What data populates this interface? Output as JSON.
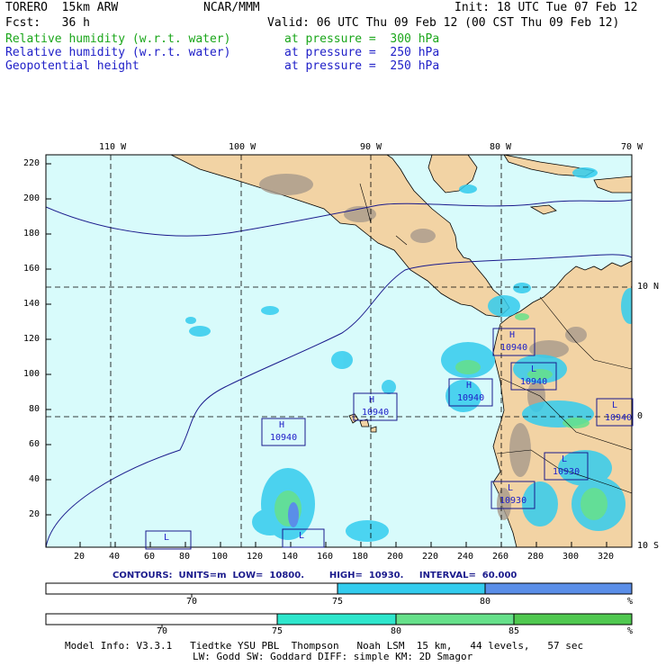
{
  "header": {
    "model": "TORERO  15km ARW",
    "center": "NCAR/MMM",
    "init": "Init: 18 UTC Tue 07 Feb 12",
    "fcst": "Fcst:   36 h",
    "valid": "Valid: 06 UTC Thu 09 Feb 12 (00 CST Thu 09 Feb 12)"
  },
  "fields": [
    {
      "name": "Relative humidity (w.r.t. water)",
      "level": "at pressure =  300 hPa",
      "color": "#1aa61a"
    },
    {
      "name": "Relative humidity (w.r.t. water)",
      "level": "at pressure =  250 hPa",
      "color": "#2020c8"
    },
    {
      "name": "Geopotential height",
      "level": "at pressure =  250 hPa",
      "color": "#2020c8"
    }
  ],
  "map": {
    "lon_labels": [
      "110 W",
      "100 W",
      "90 W",
      "80 W",
      "70 W"
    ],
    "lat_labels": [
      "10 N",
      "0",
      "10 S"
    ],
    "y_ticks": [
      "220",
      "200",
      "180",
      "160",
      "140",
      "120",
      "100",
      "80",
      "60",
      "40",
      "20"
    ],
    "x_ticks": [
      "20",
      "40",
      "60",
      "80",
      "100",
      "120",
      "140",
      "160",
      "180",
      "200",
      "220",
      "240",
      "260",
      "280",
      "300",
      "320"
    ],
    "colors": {
      "ocean": "#d8fbfb",
      "land": "#f2d3a4",
      "terrain": "#a89a8c",
      "contour": "#1a1a8c"
    },
    "highs": [
      {
        "label": "H",
        "value": "10940"
      },
      {
        "label": "H",
        "value": "10940"
      },
      {
        "label": "H",
        "value": "10940"
      },
      {
        "label": "H",
        "value": "10940"
      }
    ],
    "lows": [
      {
        "label": "L",
        "value": "10940"
      },
      {
        "label": "L",
        "value": "10940"
      },
      {
        "label": "L",
        "value": "10930"
      },
      {
        "label": "L",
        "value": "10930"
      },
      {
        "label": "L",
        "value": ""
      },
      {
        "label": "L",
        "value": "10930"
      }
    ]
  },
  "contours": {
    "text": "CONTOURS:  UNITS=m  LOW=  10800.        HIGH=  10930.     INTERVAL=  60.000",
    "units": "m",
    "low": "10800.",
    "high": "10930.",
    "interval": "60.000"
  },
  "colorbar_250": {
    "ticks": [
      "70",
      "75",
      "80"
    ],
    "unit": "%",
    "colors": [
      "#ffffff",
      "#33ccee",
      "#5a8ee8"
    ]
  },
  "colorbar_300": {
    "ticks": [
      "70",
      "75",
      "80",
      "85"
    ],
    "unit": "%",
    "colors": [
      "#ffffff",
      "#2ee6cc",
      "#66e08a",
      "#50c850"
    ]
  },
  "model_info": {
    "line1": "Model Info: V3.3.1   Tiedtke YSU PBL  Thompson   Noah LSM  15 km,   44 levels,   57 sec",
    "line2": "LW: Godd SW: Goddard DIFF: simple KM: 2D Smagor"
  }
}
